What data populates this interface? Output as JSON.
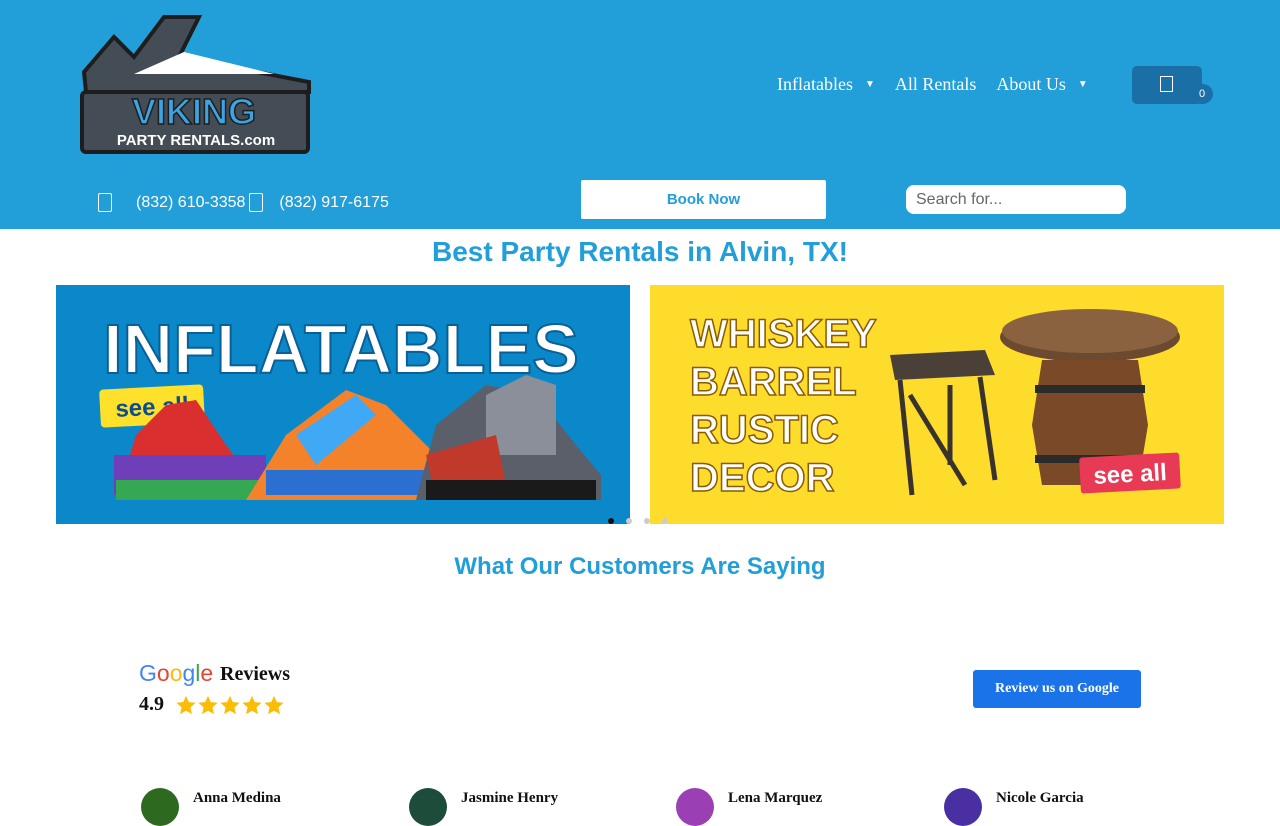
{
  "header": {
    "logo_alt": "Viking Party Rentals.com",
    "nav": [
      {
        "label": "Inflatables",
        "has_dropdown": true
      },
      {
        "label": "All Rentals",
        "has_dropdown": false
      },
      {
        "label": "About Us",
        "has_dropdown": true
      }
    ],
    "cart_count": "0",
    "phones": [
      "(832) 610-3358",
      "(832) 917-6175"
    ],
    "book_label": "Book Now",
    "search_placeholder": "Search for..."
  },
  "main": {
    "title": "Best Party Rentals in Alvin, TX!",
    "banners": [
      {
        "heading": "INFLATABLES",
        "cta": "see all",
        "bg": "#0b88c9"
      },
      {
        "heading": [
          "WHISKEY",
          "BARREL",
          "RUSTIC",
          "DECOR"
        ],
        "cta": "see all",
        "bg": "#fddc2c"
      }
    ],
    "carousel_dots": 4,
    "carousel_active": 0,
    "reviews_title": "What Our Customers Are Saying"
  },
  "reviews": {
    "brand": "Google",
    "label": "Reviews",
    "rating": "4.9",
    "stars": 5,
    "button_label": "Review us on Google",
    "reviewers": [
      {
        "name": "Anna Medina",
        "color": "#2d6a1f"
      },
      {
        "name": "Jasmine Henry",
        "color": "#1d4d3a"
      },
      {
        "name": "Lena Marquez",
        "color": "#9b3fb5"
      },
      {
        "name": "Nicole Garcia",
        "color": "#4a2fa3"
      }
    ]
  },
  "colors": {
    "brand": "#229ed9",
    "nav_dark": "#1a6fa6",
    "google_button": "#1a73e8",
    "star": "#fbbc05"
  }
}
